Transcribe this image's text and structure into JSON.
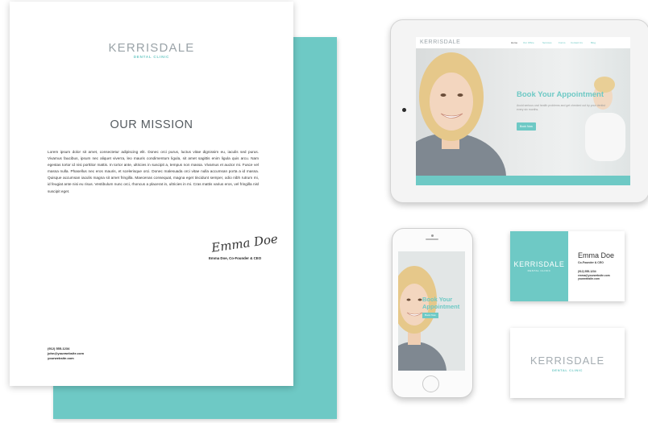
{
  "brand": {
    "name": "KERRISDALE",
    "tagline": "DENTAL CLINIC",
    "accent": "#6ec9c5"
  },
  "letterhead": {
    "title": "OUR MISSION",
    "body": "Lorem ipsum dolor sit amet, consectetur adipiscing elit. Donec orci purus, luctus vitae dignissim eu, iaculis sed purus. Vivamus faucibus, ipsum nec aliquet viverra, leo mauris condimentum ligula, sit amet sagittis enim ligula quis arcu. Nam egestas tortor id nisi porttitor mattis. In tortor ante, ultricies in suscipit a, tempus non massa. Vivamus et auctor mi. Fusce vel massa nulla. Phasellus nec eros mauris, et scelerisque orci. Donec malesuada orci vitae nulla accumsan porta a id massa. Quisque accumsan iaculis magna sit amet fringilla. Maecenas consequat, magna eget tincidunt semper, odio nibh rutrum mi, id feugiat ante nisi eu risus. Vestibulum nunc orci, rhoncus a placerat in, ultricies in mi. Cras mattis varius eros, vel fringilla nisl suscipit eget.",
    "signature": "Emma Doe",
    "signer": "Emma Doe, Co-Founder & CEO",
    "contact": {
      "phone": "(912) 555-1234",
      "email": "john@yourwebsite.com",
      "website": "yourwebsite.com"
    }
  },
  "tablet_site": {
    "logo": "KERRISDALE",
    "nav": [
      "Home",
      "Our Office",
      "Services",
      "Forms",
      "Contact Us",
      "Blog"
    ],
    "heading": "Book Your Appointment",
    "text": "Avoid serious oral health problems and get checked out by your dentist every six months.",
    "button": "Book Now"
  },
  "phone_site": {
    "heading": "Book Your Appointment",
    "button": "Book Now"
  },
  "card_front": {
    "brand": "KERRISDALE",
    "tagline": "DENTAL CLINIC",
    "name": "Emma Doe",
    "role": "Co-Founder & CEO",
    "phone": "(912) 555-1234",
    "email": "emma@yourwebsite.com",
    "website": "yourwebsite.com"
  },
  "card_back": {
    "brand": "KERRISDALE",
    "tagline": "DENTAL CLINIC"
  }
}
